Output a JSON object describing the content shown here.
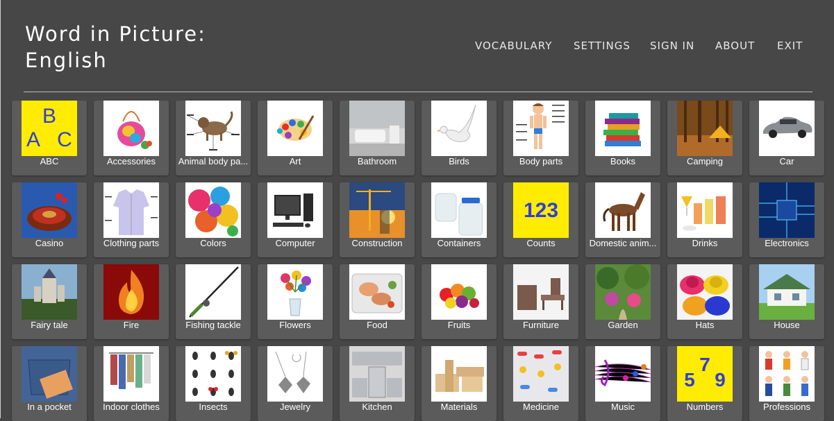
{
  "header": {
    "title_line1": "Word in Picture:",
    "title_line2": "English"
  },
  "nav": {
    "vocabulary": "VOCABULARY",
    "settings": "SETTINGS",
    "sign_in": "SIGN IN",
    "about": "ABOUT",
    "exit": "EXIT"
  },
  "colors": {
    "background": "#474747",
    "tile": "#5b5b5b",
    "yellow_card": "#ffec00",
    "blue_text": "#2f3fd6"
  },
  "categories": [
    {
      "label": "ABC",
      "icon": "abc-letters-icon"
    },
    {
      "label": "Accessories",
      "icon": "bag-icon"
    },
    {
      "label": "Animal body pa...",
      "icon": "cat-diagram-icon"
    },
    {
      "label": "Art",
      "icon": "palette-icon"
    },
    {
      "label": "Bathroom",
      "icon": "bathtub-icon"
    },
    {
      "label": "Birds",
      "icon": "dove-icon"
    },
    {
      "label": "Body parts",
      "icon": "boy-diagram-icon"
    },
    {
      "label": "Books",
      "icon": "books-icon"
    },
    {
      "label": "Camping",
      "icon": "tent-forest-icon"
    },
    {
      "label": "Car",
      "icon": "car-icon"
    },
    {
      "label": "Casino",
      "icon": "roulette-icon"
    },
    {
      "label": "Clothing parts",
      "icon": "shirt-icon"
    },
    {
      "label": "Colors",
      "icon": "paint-splash-icon"
    },
    {
      "label": "Computer",
      "icon": "computer-icon"
    },
    {
      "label": "Construction",
      "icon": "crane-icon"
    },
    {
      "label": "Containers",
      "icon": "jars-icon"
    },
    {
      "label": "Counts",
      "icon": "numbers-123-icon",
      "card_text": "123"
    },
    {
      "label": "Domestic anim...",
      "icon": "horse-icon"
    },
    {
      "label": "Drinks",
      "icon": "drinks-icon"
    },
    {
      "label": "Electronics",
      "icon": "circuit-board-icon"
    },
    {
      "label": "Fairy tale",
      "icon": "castle-icon"
    },
    {
      "label": "Fire",
      "icon": "fire-icon"
    },
    {
      "label": "Fishing tackle",
      "icon": "fishing-rod-icon"
    },
    {
      "label": "Flowers",
      "icon": "flowers-icon"
    },
    {
      "label": "Food",
      "icon": "food-plate-icon"
    },
    {
      "label": "Fruits",
      "icon": "fruits-icon"
    },
    {
      "label": "Furniture",
      "icon": "furniture-icon"
    },
    {
      "label": "Garden",
      "icon": "garden-icon"
    },
    {
      "label": "Hats",
      "icon": "hats-icon"
    },
    {
      "label": "House",
      "icon": "house-icon"
    },
    {
      "label": "In a pocket",
      "icon": "pocket-icon"
    },
    {
      "label": "Indoor clothes",
      "icon": "clothes-rack-icon"
    },
    {
      "label": "Insects",
      "icon": "insects-icon"
    },
    {
      "label": "Jewelry",
      "icon": "jewelry-icon"
    },
    {
      "label": "Kitchen",
      "icon": "kitchen-icon"
    },
    {
      "label": "Materials",
      "icon": "wood-blocks-icon"
    },
    {
      "label": "Medicine",
      "icon": "pills-icon"
    },
    {
      "label": "Music",
      "icon": "music-notes-icon"
    },
    {
      "label": "Numbers",
      "icon": "numbers-579-icon",
      "card_text": "579"
    },
    {
      "label": "Professions",
      "icon": "professions-icon"
    }
  ]
}
